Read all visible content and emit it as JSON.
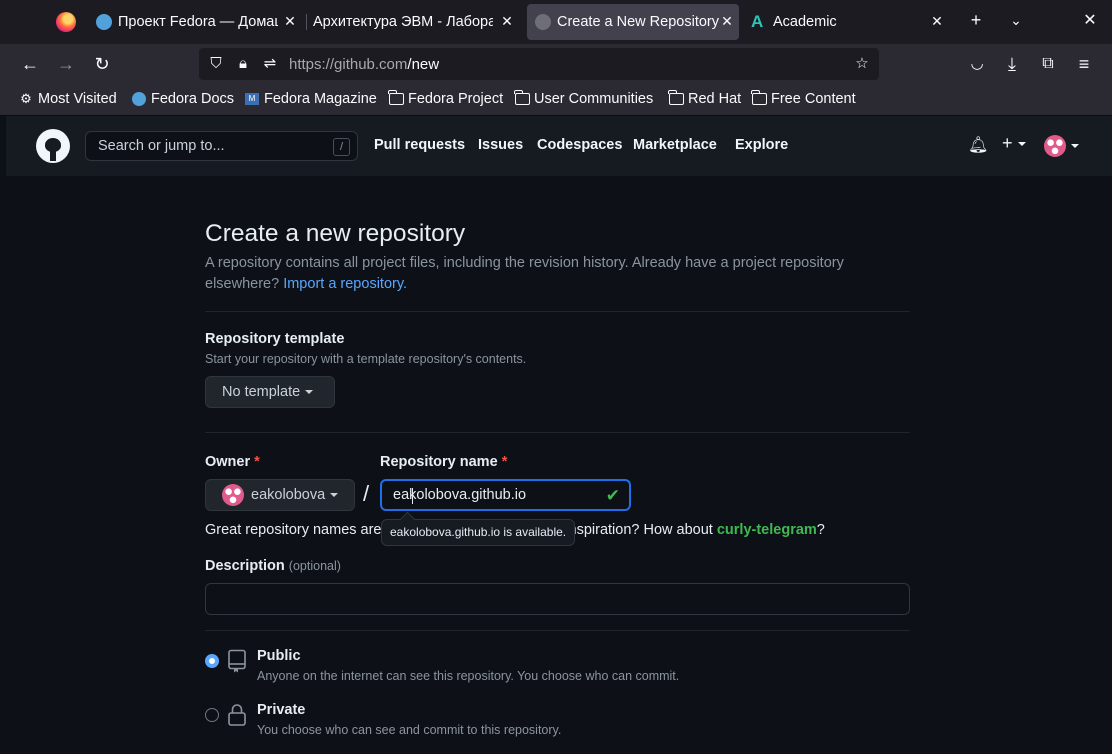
{
  "browser": {
    "tabs": [
      {
        "label": "Проект Fedora — Домашн"
      },
      {
        "label": "Архитектура ЭВМ - Лабора"
      },
      {
        "label": "Create a New Repository"
      },
      {
        "label": "Academic"
      }
    ],
    "url_host": "https://github.com",
    "url_path": "/new",
    "bookmarks": [
      {
        "label": "Most Visited",
        "icon": "gear-icon"
      },
      {
        "label": "Fedora Docs",
        "icon": "fedora-icon"
      },
      {
        "label": "Fedora Magazine",
        "icon": "magazine-icon"
      },
      {
        "label": "Fedora Project",
        "icon": "folder-icon"
      },
      {
        "label": "User Communities",
        "icon": "folder-icon"
      },
      {
        "label": "Red Hat",
        "icon": "folder-icon"
      },
      {
        "label": "Free Content",
        "icon": "folder-icon"
      }
    ]
  },
  "github": {
    "search_placeholder": "Search or jump to...",
    "search_shortcut": "/",
    "nav": [
      "Pull requests",
      "Issues",
      "Codespaces",
      "Marketplace",
      "Explore"
    ]
  },
  "form": {
    "title": "Create a new repository",
    "subtitle": "A repository contains all project files, including the revision history. Already have a project repository elsewhere?",
    "import_link": "Import a repository.",
    "template_label": "Repository template",
    "template_note": "Start your repository with a template repository's contents.",
    "template_button": "No template",
    "owner_label": "Owner",
    "required_mark": "*",
    "owner_value": "eakolobova",
    "separator": "/",
    "repo_label": "Repository name",
    "repo_value": "eakolobova.github.io",
    "tooltip": "eakolobova.github.io is available.",
    "hint_start": "Great repository names are",
    "hint_end": "nspiration? How about",
    "hint_suggestion": "curly-telegram",
    "hint_q": "?",
    "description_label": "Description",
    "description_optional": "(optional)",
    "description_value": "",
    "visibility": [
      {
        "title": "Public",
        "desc": "Anyone on the internet can see this repository. You choose who can commit.",
        "selected": true
      },
      {
        "title": "Private",
        "desc": "You choose who can see and commit to this repository.",
        "selected": false
      }
    ]
  },
  "colors": {
    "accent": "#58a6ff",
    "success": "#3fb950",
    "danger": "#f85149",
    "bg": "#0d1117"
  }
}
